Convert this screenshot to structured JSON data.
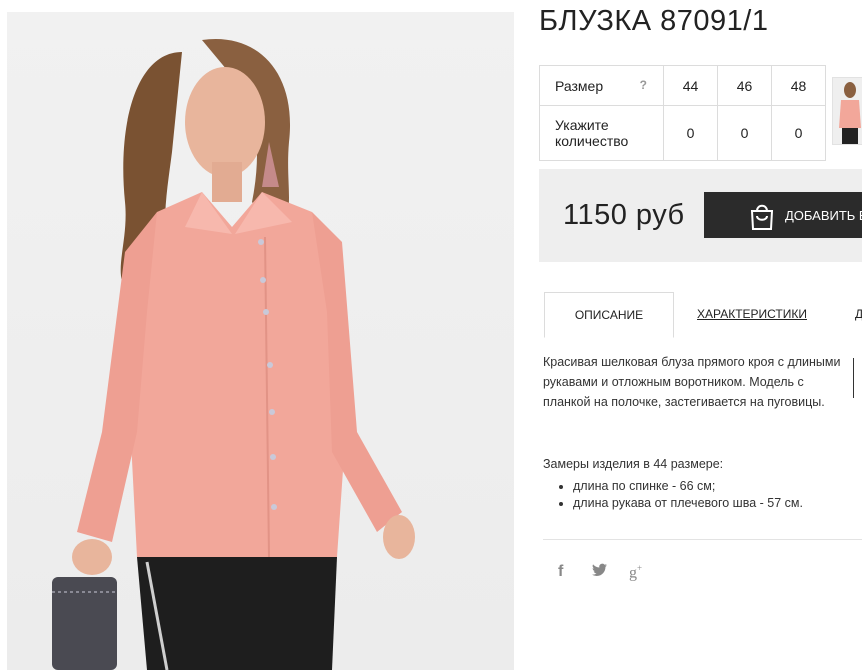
{
  "product": {
    "title": "БЛУЗКА 87091/1",
    "photo_icon": "product-photo-model-pink-blouse"
  },
  "size_table": {
    "size_label": "Размер",
    "size_hint": "?",
    "sizes": [
      "44",
      "46",
      "48"
    ],
    "qty_label": "Укажите количество",
    "quantities": [
      "0",
      "0",
      "0"
    ]
  },
  "purchase": {
    "price": "1150 руб",
    "add_to_cart_label": "ДОБАВИТЬ В",
    "cart_icon": "shopping-bag-icon"
  },
  "tabs": {
    "items": [
      {
        "label": "ОПИСАНИЕ"
      },
      {
        "label": "ХАРАКТЕРИСТИКИ"
      },
      {
        "label": "Д"
      }
    ]
  },
  "description": {
    "text": "Красивая шелковая блуза прямого кроя с длиными рукавами и отложным воротником. Модель с планкой на полочке, застегивается на пуговицы.",
    "measure_title": "Замеры изделия в 44 размере:",
    "measures": [
      "длина по спинке - 66 см;",
      "длина рукава от плечевого шва - 57 см."
    ]
  },
  "social": {
    "facebook_glyph": "f",
    "google_glyph": "g",
    "google_sup": "+",
    "icons": [
      "facebook-icon",
      "twitter-icon",
      "google-plus-icon"
    ]
  },
  "colors": {
    "blouse": "#f2a79a",
    "button_bg": "#2b2b2b",
    "price_bar_bg": "#eeeeee"
  }
}
